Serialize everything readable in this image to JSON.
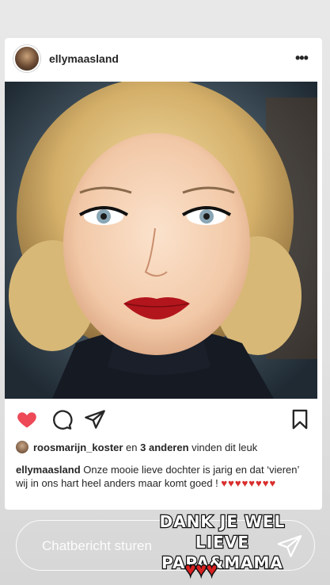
{
  "post": {
    "username": "ellymaasland",
    "more_label": "•••"
  },
  "likes": {
    "first_liker": "roosmarijn_koster",
    "connector": " en ",
    "others": "3 anderen",
    "suffix": " vinden dit leuk"
  },
  "caption": {
    "username": "ellymaasland",
    "text": " Onze mooie lieve dochter is jarig en dat ‘vieren’ wij in ons hart heel anders maar komt goed ! ",
    "hearts": "♥♥♥♥♥♥♥♥"
  },
  "reply": {
    "placeholder": "Chatbericht sturen"
  },
  "sticker": {
    "line1": "DANK JE WEL LIEVE",
    "line2": "PAPA&MAMA",
    "hearts": "♥♥♥"
  },
  "colors": {
    "like_red": "#ed4956",
    "heart_red": "#d92d2d"
  },
  "icons": {
    "like": "heart-icon",
    "comment": "comment-icon",
    "share": "paper-plane-icon",
    "save": "bookmark-icon",
    "send": "send-icon",
    "more": "more-icon"
  }
}
